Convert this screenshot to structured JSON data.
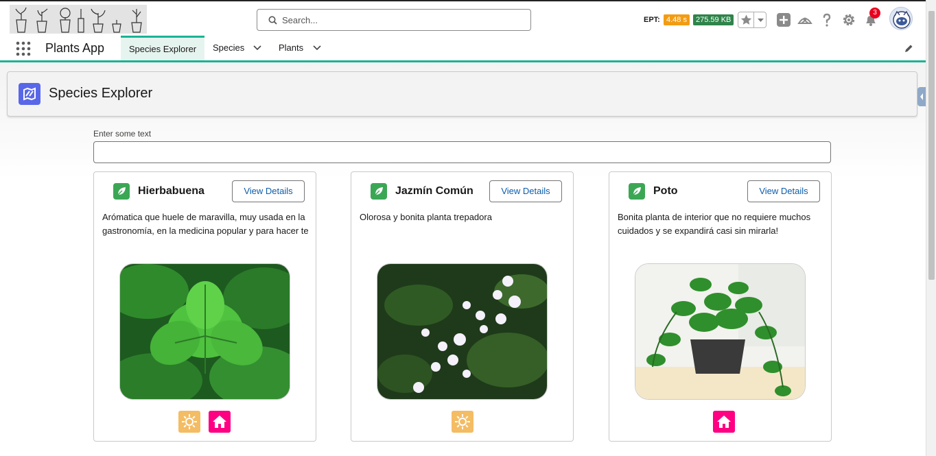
{
  "header": {
    "search_placeholder": "Search...",
    "ept_label": "EPT:",
    "ept_time": "4.48 s",
    "ept_size": "275.59 KB",
    "notification_count": "3"
  },
  "nav": {
    "app_name": "Plants App",
    "tabs": [
      {
        "label": "Species Explorer",
        "active": true
      },
      {
        "label": "Species",
        "has_menu": true
      },
      {
        "label": "Plants",
        "has_menu": true
      }
    ]
  },
  "page": {
    "title": "Species Explorer",
    "filter_label": "Enter some text",
    "filter_value": ""
  },
  "species": [
    {
      "name": "Hierbabuena",
      "button": "View Details",
      "description": "Arómatica que huele de maravilla, muy usada en la gastronomía, en la medicina popular y para hacer te",
      "photo": "mint-leaves",
      "tags": [
        "sun-icon",
        "home-icon"
      ]
    },
    {
      "name": "Jazmín Común",
      "button": "View Details",
      "description": "Olorosa y bonita planta trepadora",
      "photo": "white-jasmine-flowers",
      "tags": [
        "sun-icon"
      ]
    },
    {
      "name": "Poto",
      "button": "View Details",
      "description": "Bonita planta de interior que no requiere muchos cuidados y se expandirá casi sin mirarla!",
      "photo": "pothos-in-pot",
      "tags": [
        "home-icon"
      ]
    }
  ],
  "colors": {
    "accent": "#1ab394",
    "leaf_icon": "#3ba755",
    "sun_tag": "#f4bc63",
    "home_tag": "#ff0083",
    "badge_time": "#f39c12",
    "badge_size": "#2e844a"
  }
}
